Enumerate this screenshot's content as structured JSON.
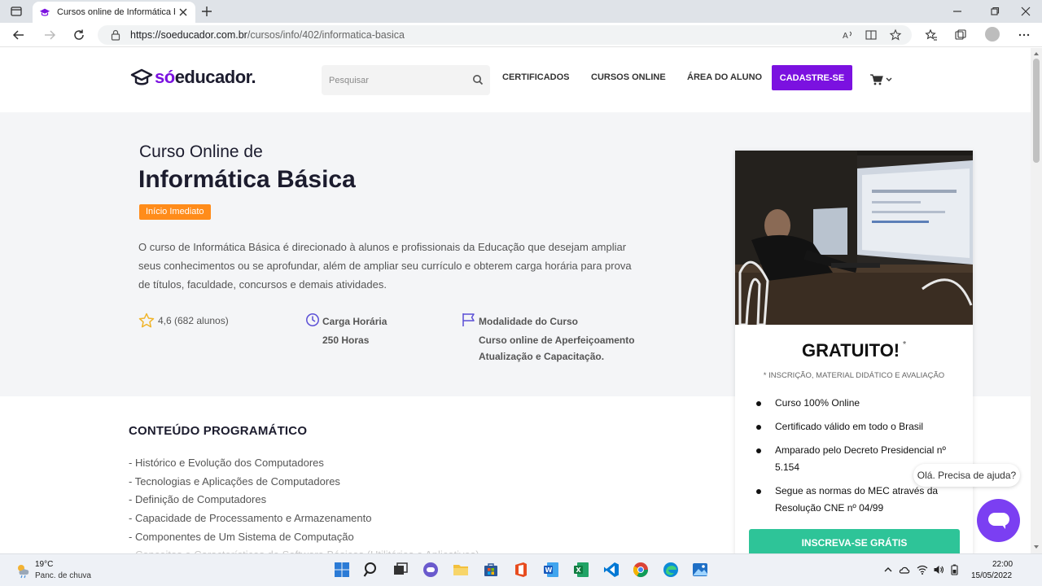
{
  "browser": {
    "tab_title": "Cursos online de Informática bás",
    "url_host": "https://soeducador.com.br",
    "url_path": "/cursos/info/402/informatica-basica"
  },
  "header": {
    "logo_so": "só",
    "logo_rest": "educador.",
    "search_placeholder": "Pesquisar",
    "nav": [
      "CERTIFICADOS",
      "CURSOS ONLINE",
      "ÁREA DO ALUNO"
    ],
    "cta": "CADASTRE-SE",
    "accent": "#7b11e0"
  },
  "hero": {
    "pre_title": "Curso Online de",
    "title": "Informática Básica",
    "badge": "Início Imediato",
    "description": "O curso de Informática Básica é direcionado à alunos e profissionais da Educação que desejam ampliar seus conhecimentos ou se aprofundar, além de ampliar seu currículo e obterem carga horária para prova de títulos, faculdade, concursos e demais atividades.",
    "rating": "4,6 (682 alunos)",
    "workload_label": "Carga Horária",
    "workload_value": "250 Horas",
    "modality_label": "Modalidade do Curso",
    "modality_line1": "Curso online de Aperfeiçoamento",
    "modality_line2": "Atualização e Capacitação."
  },
  "content": {
    "title": "CONTEÚDO PROGRAMÁTICO",
    "topics": [
      "- Histórico e Evolução dos Computadores",
      "- Tecnologias e Aplicações de Computadores",
      "- Definição de Computadores",
      "- Capacidade de Processamento e Armazenamento",
      "- Componentes de Um Sistema de Computação",
      "- Conceitos e Características de Software Básicos (Utilitários e Aplicativos)"
    ]
  },
  "card": {
    "price": "GRATUITO!",
    "price_mark": "*",
    "price_note": "* INSCRIÇÃO, MATERIAL DIDÁTICO E AVALIAÇÃO",
    "benefits": [
      "Curso 100% Online",
      "Certificado válido em todo o Brasil",
      "Amparado pelo Decreto Presidencial nº 5.154",
      "Segue as normas do MEC através da Resolução CNE nº 04/99"
    ],
    "button": "INSCREVA-SE GRÁTIS",
    "button_color": "#2ec498"
  },
  "chat": {
    "bubble": "Olá. Precisa de ajuda?"
  },
  "taskbar": {
    "temp": "19°C",
    "weather": "Panc. de chuva",
    "time": "22:00",
    "date": "15/05/2022"
  }
}
